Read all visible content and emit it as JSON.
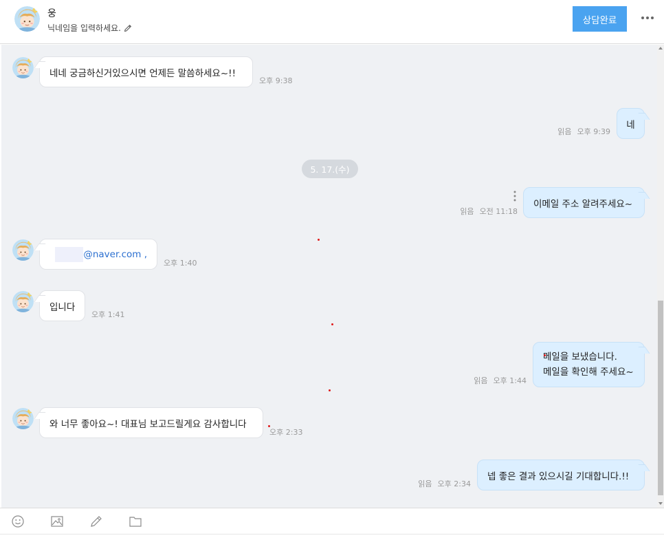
{
  "header": {
    "name": "웅",
    "nickname_placeholder": "닉네임을 입력하세요.",
    "done_button": "상담완료"
  },
  "date_divider": "5. 17.(수)",
  "messages": [
    {
      "from": "other",
      "text": "네네 궁금하신거있으시면 언제든 말씀하세요~!!",
      "time": "오후 9:38"
    },
    {
      "from": "me",
      "text": "네",
      "read": "읽음",
      "time": "오후 9:39"
    },
    {
      "from": "me",
      "text": "이메일 주소 알려주세요~",
      "read": "읽음",
      "time": "오전 11:18"
    },
    {
      "from": "other",
      "text": "@naver.com ,",
      "time": "오후 1:40"
    },
    {
      "from": "other",
      "text": "입니다",
      "time": "오후 1:41"
    },
    {
      "from": "me",
      "line1": "메일을 보냈습니다.",
      "line2": "메일을 확인해 주세요~",
      "read": "읽음",
      "time": "오후 1:44"
    },
    {
      "from": "other",
      "text": "와 너무 좋아요~! 대표님 보고드릴게요 감사합니다",
      "time": "오후 2:33"
    },
    {
      "from": "me",
      "text": "넵 좋은 결과 있으시길 기대합니다.!!",
      "read": "읽음",
      "time": "오후 2:34"
    }
  ],
  "toolbar": {
    "icons": [
      "emoji-icon",
      "image-icon",
      "pencil-icon",
      "folder-icon"
    ]
  },
  "colors": {
    "accent": "#4aa3f0",
    "chat_bg": "#eff1f4",
    "my_bubble": "#dcefff",
    "link": "#2b6fd0"
  }
}
